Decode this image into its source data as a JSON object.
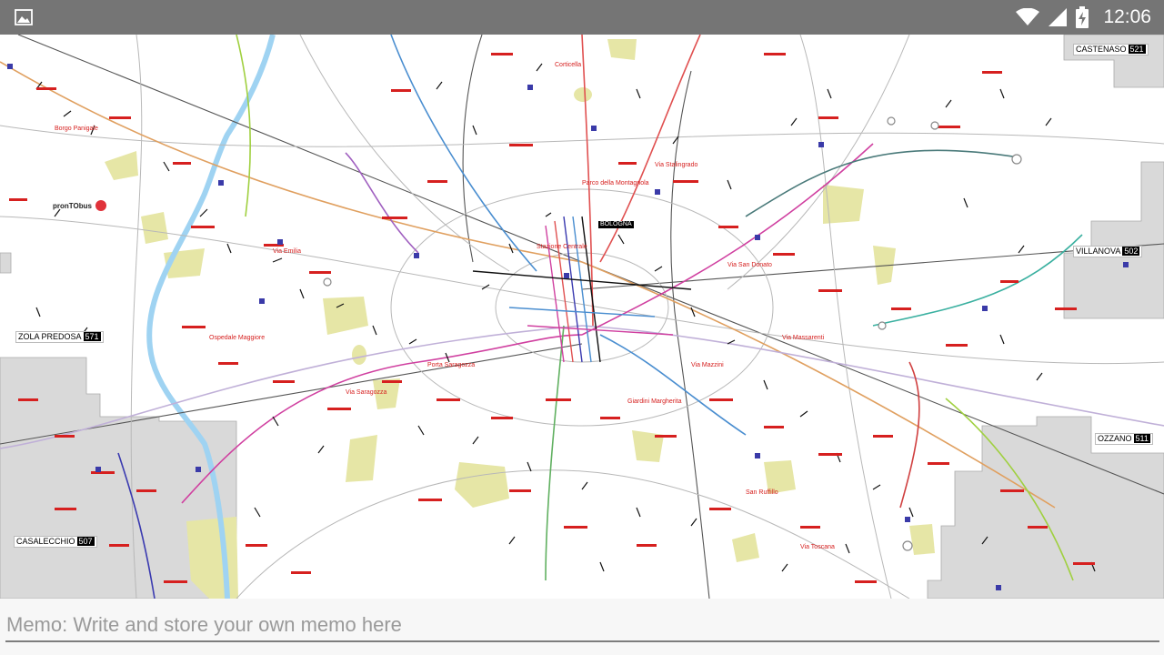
{
  "status_bar": {
    "time": "12:06",
    "icons": [
      "image-notification-icon",
      "wifi-icon",
      "cellular-signal-icon",
      "battery-charging-icon"
    ],
    "background_color": "#757575"
  },
  "map": {
    "brand_text": "pronTObus",
    "towns": [
      {
        "name": "CASTENASO",
        "code": "521"
      },
      {
        "name": "VILLANOVA",
        "code": "502"
      },
      {
        "name": "ZOLA PREDOSA",
        "code": "571"
      },
      {
        "name": "OZZANO",
        "code": "511"
      },
      {
        "name": "CASALECCHIO",
        "code": "507"
      }
    ],
    "street_labels": [
      "BOLOGNA",
      "Via Emilia",
      "Ospedale Maggiore",
      "Stazione Centrale",
      "Giardini Margherita",
      "Via Stalingrado",
      "Porta Saragozza",
      "San Ruffillo",
      "Via Massarenti",
      "Via San Donato",
      "Corticella",
      "Borgo Panigale",
      "Via Mazzini",
      "Via Saragozza",
      "Parco della Montagnola",
      "Via Toscana"
    ],
    "colors": {
      "labels": "#d6201f",
      "stops": "#3a3aa8",
      "parks": "#e6e6a6",
      "rail": "#555555"
    }
  },
  "memo": {
    "placeholder": "Memo: Write and store your own memo here",
    "value": ""
  }
}
